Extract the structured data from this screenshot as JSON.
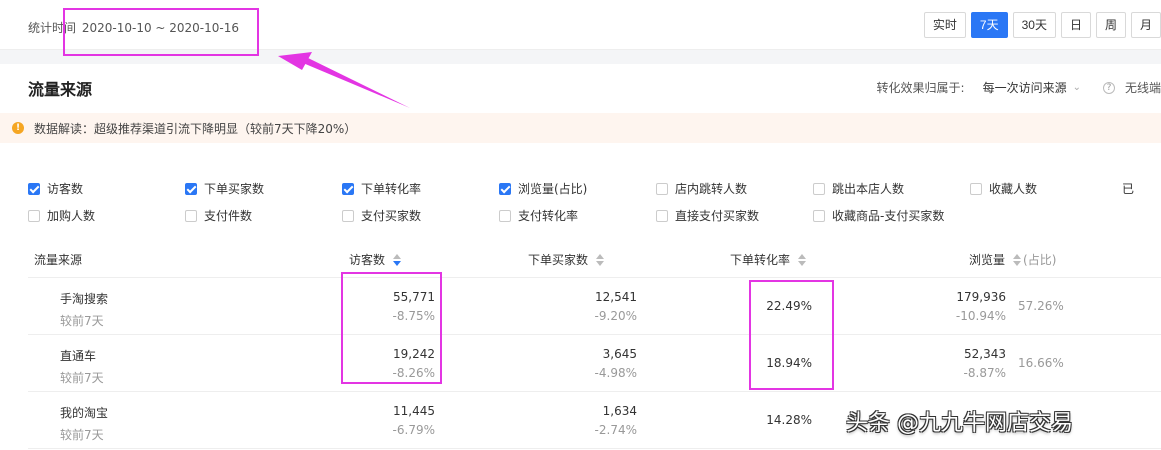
{
  "header": {
    "period_label": "统计时间",
    "period_range": "2020-10-10 ~ 2020-10-16",
    "range_buttons": [
      "实时",
      "7天",
      "30天",
      "日",
      "周",
      "月"
    ],
    "active_range": "7天"
  },
  "section": {
    "title": "流量来源",
    "attribution_label": "转化效果归属于:",
    "attribution_value": "每一次访问来源",
    "device_label": "无线端"
  },
  "notice": {
    "text": "数据解读：超级推荐渠道引流下降明显（较前7天下降20%）"
  },
  "metrics": [
    {
      "label": "访客数",
      "checked": true
    },
    {
      "label": "下单买家数",
      "checked": true
    },
    {
      "label": "下单转化率",
      "checked": true
    },
    {
      "label": "浏览量(占比)",
      "checked": true
    },
    {
      "label": "店内跳转人数",
      "checked": false
    },
    {
      "label": "跳出本店人数",
      "checked": false
    },
    {
      "label": "收藏人数",
      "checked": false
    },
    {
      "label": "已",
      "checked": false
    },
    {
      "label": "加购人数",
      "checked": false
    },
    {
      "label": "支付件数",
      "checked": false
    },
    {
      "label": "支付买家数",
      "checked": false
    },
    {
      "label": "支付转化率",
      "checked": false
    },
    {
      "label": "直接支付买家数",
      "checked": false
    },
    {
      "label": "收藏商品-支付买家数",
      "checked": false
    }
  ],
  "table": {
    "columns": {
      "source": "流量来源",
      "visitors": "访客数",
      "buyers": "下单买家数",
      "conversion": "下单转化率",
      "pageviews": "浏览量",
      "share": "(占比)"
    },
    "rows": [
      {
        "source": "手淘搜索",
        "compare": "较前7天",
        "visitors": "55,771",
        "visitors_delta": "-8.75%",
        "buyers": "12,541",
        "buyers_delta": "-9.20%",
        "conversion": "22.49%",
        "pageviews": "179,936",
        "pageviews_delta": "-10.94%",
        "share": "57.26%"
      },
      {
        "source": "直通车",
        "compare": "较前7天",
        "visitors": "19,242",
        "visitors_delta": "-8.26%",
        "buyers": "3,645",
        "buyers_delta": "-4.98%",
        "conversion": "18.94%",
        "pageviews": "52,343",
        "pageviews_delta": "-8.87%",
        "share": "16.66%"
      },
      {
        "source": "我的淘宝",
        "compare": "较前7天",
        "visitors": "11,445",
        "visitors_delta": "-6.79%",
        "buyers": "1,634",
        "buyers_delta": "-2.74%",
        "conversion": "14.28%",
        "pageviews": "",
        "pageviews_delta": "",
        "share": ""
      }
    ]
  },
  "watermark": "头条 @九九牛网店交易",
  "colors": {
    "accent": "#2a77f5",
    "highlight": "#e335e3",
    "notice_bg": "#fef5ef",
    "warning": "#f5a623"
  }
}
